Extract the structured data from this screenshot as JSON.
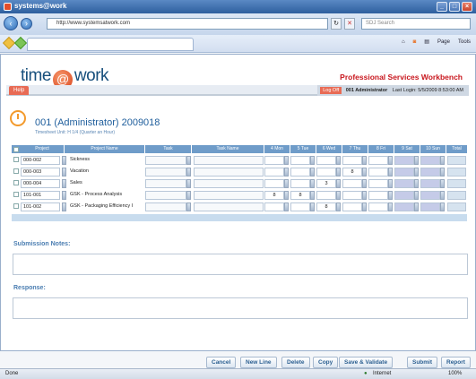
{
  "window": {
    "title": "systems@work"
  },
  "browser": {
    "url": "http://www.systemsatwork.com",
    "search_placeholder": "SDJ Search",
    "toolbar": {
      "page": "Page",
      "tools": "Tools"
    }
  },
  "app": {
    "logo_left": "time",
    "logo_at": "@",
    "logo_right": "work",
    "product": "Professional Services Workbench",
    "help": "Help",
    "log_off": "Log Off",
    "user": "001 Administrator",
    "last_login": "Last Login: 5/5/2009 8:53:00 AM"
  },
  "timesheet": {
    "title": "001 (Administrator) 2009018",
    "subtitle": "Timesheet Unit: H 1/4 (Quarter an Hour)"
  },
  "grid": {
    "headers": [
      "Project",
      "Project Name",
      "Task",
      "Task Name",
      "4 Mon",
      "5 Tue",
      "6 Wed",
      "7 Thu",
      "8 Fri",
      "9 Sat",
      "10 Sun",
      "Total"
    ],
    "rows": [
      {
        "project": "000-002",
        "name": "Sickness",
        "hours": [
          "",
          "",
          "",
          "",
          "",
          "",
          ""
        ]
      },
      {
        "project": "000-003",
        "name": "Vacation",
        "hours": [
          "",
          "",
          "",
          "8",
          "",
          "",
          ""
        ]
      },
      {
        "project": "000-004",
        "name": "Sales",
        "hours": [
          "",
          "",
          "3",
          "",
          "",
          "",
          ""
        ]
      },
      {
        "project": "101-001",
        "name": "GSK - Process Analysis",
        "hours": [
          "8",
          "8",
          "",
          "",
          "",
          "",
          ""
        ]
      },
      {
        "project": "101-002",
        "name": "GSK - Packaging Efficiency I",
        "hours": [
          "",
          "",
          "8",
          "",
          "",
          "",
          ""
        ]
      }
    ],
    "totals": [
      "",
      "",
      "",
      "",
      "",
      "",
      "",
      ""
    ]
  },
  "sections": {
    "notes": "Submission Notes:",
    "response": "Response:"
  },
  "buttons": {
    "cancel": "Cancel",
    "new_line": "New Line",
    "delete": "Delete",
    "copy": "Copy",
    "save_validate": "Save & Validate",
    "submit": "Submit",
    "report": "Report"
  },
  "status": {
    "left": "Done",
    "zone": "Internet",
    "zoom": "100%"
  }
}
